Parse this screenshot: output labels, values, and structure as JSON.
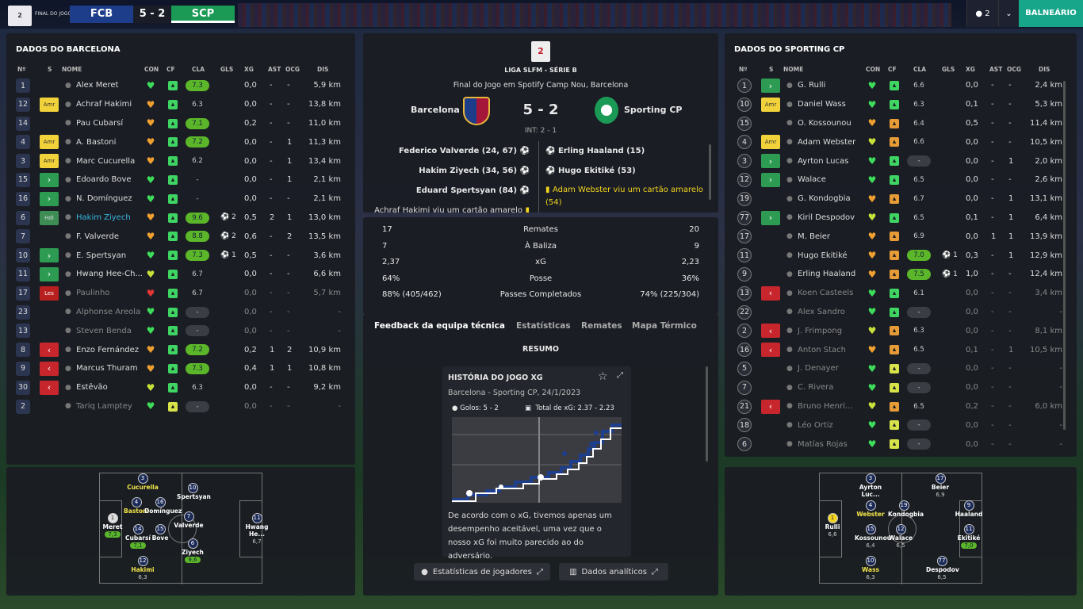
{
  "topbar": {
    "final_label": "FINAL DO JOGO",
    "home": "FCB",
    "score": "5 - 2",
    "away": "SCP",
    "players_count": "2",
    "dropdown": "⌄",
    "balneario": "BALNEÁRIO"
  },
  "left": {
    "title": "DADOS DO BARCELONA",
    "headers": {
      "n": "Nº",
      "s": "S",
      "name": "NOME",
      "con": "CON",
      "cf": "CF",
      "cla": "CLA",
      "gls": "GLS",
      "xg": "XG",
      "ast": "AST",
      "ocg": "OCG",
      "dis": "DIS"
    },
    "rows": [
      {
        "n": "1",
        "s": "",
        "name": "Alex Meret",
        "con": "g",
        "cf": "g",
        "cla": "7.3",
        "clat": "g",
        "gls": "",
        "xg": "0,0",
        "ast": "-",
        "ocg": "-",
        "dis": "5,9 km",
        "circ": false
      },
      {
        "n": "12",
        "s": "Amr",
        "name": "Achraf Hakimi",
        "con": "o",
        "cf": "g",
        "cla": "6.3",
        "clat": "t",
        "gls": "",
        "xg": "0,0",
        "ast": "-",
        "ocg": "-",
        "dis": "13,8 km",
        "circ": false
      },
      {
        "n": "14",
        "s": "",
        "name": "Pau Cubarsí",
        "con": "o",
        "cf": "g",
        "cla": "7.1",
        "clat": "g",
        "gls": "",
        "xg": "0,2",
        "ast": "-",
        "ocg": "-",
        "dis": "11,0 km",
        "circ": false
      },
      {
        "n": "4",
        "s": "Amr",
        "name": "A. Bastoni",
        "con": "o",
        "cf": "g",
        "cla": "7.2",
        "clat": "g",
        "gls": "",
        "xg": "0,0",
        "ast": "-",
        "ocg": "1",
        "dis": "11,3 km",
        "circ": false
      },
      {
        "n": "3",
        "s": "Amr",
        "name": "Marc Cucurella",
        "con": "o",
        "cf": "g",
        "cla": "6.2",
        "clat": "t",
        "gls": "",
        "xg": "0,0",
        "ast": "-",
        "ocg": "1",
        "dis": "13,4 km",
        "circ": false
      },
      {
        "n": "15",
        "s": "in",
        "name": "Edoardo Bove",
        "con": "g",
        "cf": "g",
        "cla": "-",
        "clat": "t",
        "gls": "",
        "xg": "0,0",
        "ast": "-",
        "ocg": "1",
        "dis": "2,1 km",
        "circ": false
      },
      {
        "n": "16",
        "s": "in",
        "name": "N. Domínguez",
        "con": "g",
        "cf": "g",
        "cla": "-",
        "clat": "t",
        "gls": "",
        "xg": "0,0",
        "ast": "-",
        "ocg": "-",
        "dis": "2,1 km",
        "circ": false
      },
      {
        "n": "6",
        "s": "Hdl",
        "name": "Hakim Ziyech",
        "con": "o",
        "cf": "g",
        "cla": "9.6",
        "clat": "g",
        "gls": "2",
        "xg": "0,5",
        "ast": "2",
        "ocg": "1",
        "dis": "13,0 km",
        "circ": false,
        "hl": true
      },
      {
        "n": "7",
        "s": "",
        "name": "F. Valverde",
        "con": "o",
        "cf": "g",
        "cla": "8.8",
        "clat": "g",
        "gls": "2",
        "xg": "0,6",
        "ast": "-",
        "ocg": "2",
        "dis": "13,5 km",
        "circ": false
      },
      {
        "n": "10",
        "s": "in",
        "name": "E. Spertsyan",
        "con": "g",
        "cf": "g",
        "cla": "7.3",
        "clat": "g",
        "gls": "1",
        "xg": "0,5",
        "ast": "-",
        "ocg": "-",
        "dis": "3,6 km",
        "circ": false
      },
      {
        "n": "11",
        "s": "in",
        "name": "Hwang Hee-Ch...",
        "con": "y",
        "cf": "g",
        "cla": "6.7",
        "clat": "t",
        "gls": "",
        "xg": "0,0",
        "ast": "-",
        "ocg": "-",
        "dis": "6,6 km",
        "circ": false
      },
      {
        "n": "17",
        "s": "Les",
        "name": "Paulinho",
        "con": "r",
        "cf": "g",
        "cla": "6.7",
        "clat": "t",
        "gls": "",
        "xg": "0,0",
        "ast": "-",
        "ocg": "-",
        "dis": "5,7 km",
        "circ": false,
        "dim": true
      },
      {
        "n": "23",
        "s": "",
        "name": "Alphonse Areola",
        "con": "g",
        "cf": "g",
        "cla": "-",
        "clat": "dk",
        "gls": "",
        "xg": "0,0",
        "ast": "-",
        "ocg": "-",
        "dis": "-",
        "circ": false,
        "dim": true
      },
      {
        "n": "13",
        "s": "",
        "name": "Steven Benda",
        "con": "g",
        "cf": "g",
        "cla": "-",
        "clat": "dk",
        "gls": "",
        "xg": "0,0",
        "ast": "-",
        "ocg": "-",
        "dis": "-",
        "circ": false,
        "dim": true
      },
      {
        "n": "8",
        "s": "out",
        "name": "Enzo Fernández",
        "con": "o",
        "cf": "g",
        "cla": "7.2",
        "clat": "g",
        "gls": "",
        "xg": "0,2",
        "ast": "1",
        "ocg": "2",
        "dis": "10,9 km",
        "circ": false
      },
      {
        "n": "9",
        "s": "out",
        "name": "Marcus Thuram",
        "con": "o",
        "cf": "g",
        "cla": "7.3",
        "clat": "g",
        "gls": "",
        "xg": "0,4",
        "ast": "1",
        "ocg": "1",
        "dis": "10,8 km",
        "circ": false
      },
      {
        "n": "30",
        "s": "out",
        "name": "Estêvão",
        "con": "y",
        "cf": "g",
        "cla": "6.3",
        "clat": "t",
        "gls": "",
        "xg": "0,0",
        "ast": "-",
        "ocg": "-",
        "dis": "9,2 km",
        "circ": false
      },
      {
        "n": "2",
        "s": "",
        "name": "Tariq Lamptey",
        "con": "g",
        "cf": "y",
        "cla": "-",
        "clat": "dk",
        "gls": "",
        "xg": "0,0",
        "ast": "-",
        "ocg": "-",
        "dis": "-",
        "circ": false,
        "dim": true
      }
    ]
  },
  "right": {
    "title": "DADOS DO SPORTING CP",
    "headers": {
      "n": "Nº",
      "s": "S",
      "name": "NOME",
      "con": "CON",
      "cf": "CF",
      "cla": "CLA",
      "gls": "GLS",
      "xg": "XG",
      "ast": "AST",
      "ocg": "OCG",
      "dis": "DIS"
    },
    "rows": [
      {
        "n": "1",
        "s": "in",
        "name": "G. Rulli",
        "con": "g",
        "cf": "g",
        "cla": "6.6",
        "clat": "t",
        "gls": "",
        "xg": "0,0",
        "ast": "-",
        "ocg": "-",
        "dis": "2,4 km",
        "circ": true
      },
      {
        "n": "10",
        "s": "Amr",
        "name": "Daniel Wass",
        "con": "g",
        "cf": "g",
        "cla": "6.3",
        "clat": "t",
        "gls": "",
        "xg": "0,1",
        "ast": "-",
        "ocg": "-",
        "dis": "5,3 km",
        "circ": true
      },
      {
        "n": "15",
        "s": "",
        "name": "O. Kossounou",
        "con": "o",
        "cf": "o",
        "cla": "6.4",
        "clat": "t",
        "gls": "",
        "xg": "0,5",
        "ast": "-",
        "ocg": "-",
        "dis": "11,4 km",
        "circ": true
      },
      {
        "n": "4",
        "s": "Amr",
        "name": "Adam Webster",
        "con": "y",
        "cf": "o",
        "cla": "6.6",
        "clat": "t",
        "gls": "",
        "xg": "0,0",
        "ast": "-",
        "ocg": "-",
        "dis": "10,5 km",
        "circ": true
      },
      {
        "n": "3",
        "s": "in",
        "name": "Ayrton Lucas",
        "con": "g",
        "cf": "g",
        "cla": "-",
        "clat": "dk",
        "gls": "",
        "xg": "0,0",
        "ast": "-",
        "ocg": "1",
        "dis": "2,0 km",
        "circ": true
      },
      {
        "n": "12",
        "s": "in",
        "name": "Walace",
        "con": "g",
        "cf": "g",
        "cla": "6.5",
        "clat": "t",
        "gls": "",
        "xg": "0,0",
        "ast": "-",
        "ocg": "-",
        "dis": "2,6 km",
        "circ": true
      },
      {
        "n": "19",
        "s": "",
        "name": "G. Kondogbia",
        "con": "o",
        "cf": "o",
        "cla": "6.7",
        "clat": "t",
        "gls": "",
        "xg": "0,0",
        "ast": "-",
        "ocg": "1",
        "dis": "13,1 km",
        "circ": true
      },
      {
        "n": "77",
        "s": "in",
        "name": "Kiril Despodov",
        "con": "y",
        "cf": "g",
        "cla": "6.5",
        "clat": "t",
        "gls": "",
        "xg": "0,1",
        "ast": "-",
        "ocg": "1",
        "dis": "6,4 km",
        "circ": true
      },
      {
        "n": "17",
        "s": "",
        "name": "M. Beier",
        "con": "o",
        "cf": "o",
        "cla": "6.9",
        "clat": "t",
        "gls": "",
        "xg": "0,0",
        "ast": "1",
        "ocg": "1",
        "dis": "13,9 km",
        "circ": true
      },
      {
        "n": "11",
        "s": "",
        "name": "Hugo Ekitiké",
        "con": "o",
        "cf": "o",
        "cla": "7.0",
        "clat": "g",
        "gls": "1",
        "xg": "0,3",
        "ast": "-",
        "ocg": "1",
        "dis": "12,9 km",
        "circ": true
      },
      {
        "n": "9",
        "s": "",
        "name": "Erling Haaland",
        "con": "o",
        "cf": "o",
        "cla": "7.5",
        "clat": "g",
        "gls": "1",
        "xg": "1,0",
        "ast": "-",
        "ocg": "-",
        "dis": "12,4 km",
        "circ": true
      },
      {
        "n": "13",
        "s": "out",
        "name": "Koen Casteels",
        "con": "g",
        "cf": "g",
        "cla": "6.1",
        "clat": "t",
        "gls": "",
        "xg": "0,0",
        "ast": "-",
        "ocg": "-",
        "dis": "3,4 km",
        "circ": true,
        "dim": true
      },
      {
        "n": "22",
        "s": "",
        "name": "Alex Sandro",
        "con": "g",
        "cf": "g",
        "cla": "-",
        "clat": "dk",
        "gls": "",
        "xg": "0,0",
        "ast": "-",
        "ocg": "-",
        "dis": "-",
        "circ": true,
        "dim": true
      },
      {
        "n": "2",
        "s": "out",
        "name": "J. Frimpong",
        "con": "y",
        "cf": "o",
        "cla": "6.3",
        "clat": "t",
        "gls": "",
        "xg": "0,0",
        "ast": "-",
        "ocg": "-",
        "dis": "8,1 km",
        "circ": true,
        "dim": true
      },
      {
        "n": "16",
        "s": "out",
        "name": "Anton Stach",
        "con": "o",
        "cf": "o",
        "cla": "6.5",
        "clat": "t",
        "gls": "",
        "xg": "0,1",
        "ast": "-",
        "ocg": "1",
        "dis": "10,5 km",
        "circ": true,
        "dim": true
      },
      {
        "n": "5",
        "s": "",
        "name": "J. Denayer",
        "con": "g",
        "cf": "y",
        "cla": "-",
        "clat": "dk",
        "gls": "",
        "xg": "0,0",
        "ast": "-",
        "ocg": "-",
        "dis": "-",
        "circ": true,
        "dim": true
      },
      {
        "n": "7",
        "s": "",
        "name": "C. Rivera",
        "con": "g",
        "cf": "y",
        "cla": "-",
        "clat": "dk",
        "gls": "",
        "xg": "0,0",
        "ast": "-",
        "ocg": "-",
        "dis": "-",
        "circ": true,
        "dim": true
      },
      {
        "n": "21",
        "s": "out",
        "name": "Bruno Henri...",
        "con": "y",
        "cf": "o",
        "cla": "6.5",
        "clat": "t",
        "gls": "",
        "xg": "0,2",
        "ast": "-",
        "ocg": "-",
        "dis": "6,0 km",
        "circ": true,
        "dim": true
      },
      {
        "n": "18",
        "s": "",
        "name": "Léo Ortiz",
        "con": "g",
        "cf": "y",
        "cla": "-",
        "clat": "dk",
        "gls": "",
        "xg": "0,0",
        "ast": "-",
        "ocg": "-",
        "dis": "-",
        "circ": true,
        "dim": true
      },
      {
        "n": "6",
        "s": "",
        "name": "Matías Rojas",
        "con": "g",
        "cf": "y",
        "cla": "-",
        "clat": "dk",
        "gls": "",
        "xg": "0,0",
        "ast": "-",
        "ocg": "-",
        "dis": "-",
        "circ": true,
        "dim": true
      }
    ]
  },
  "match": {
    "competition": "LIGA SLFM - SÉRIE B",
    "venue": "Final do Jogo em Spotify Camp Nou, Barcelona",
    "home": "Barcelona",
    "away": "Sporting CP",
    "score": "5 - 2",
    "interval": "INT: 2 - 1",
    "home_events": [
      "Federico Valverde (24, 67)",
      "Hakim Ziyech (34, 56)",
      "Eduard Spertsyan (84)",
      "Achraf Hakimi viu um cartão amarelo"
    ],
    "away_events": [
      "Erling Haaland (15)",
      "Hugo Ekitiké (53)",
      "Adam Webster viu um cartão amarelo (54)"
    ],
    "stats": [
      {
        "home": "17",
        "label": "Remates",
        "away": "20"
      },
      {
        "home": "7",
        "label": "À Baliza",
        "away": "9"
      },
      {
        "home": "2,37",
        "label": "xG",
        "away": "2,23"
      },
      {
        "home": "64%",
        "label": "Posse",
        "away": "36%"
      },
      {
        "home": "88% (405/462)",
        "label": "Passes Completados",
        "away": "74% (225/304)"
      }
    ],
    "tabs": [
      "Feedback da equipa técnica",
      "Estatísticas",
      "Remates",
      "Mapa Térmico"
    ],
    "resumo": "RESUMO",
    "xg_card": {
      "title": "HISTÓRIA DO JOGO XG",
      "subtitle": "Barcelona - Sporting CP, 24/1/2023",
      "goals": "Golos: 5 - 2",
      "xg_total": "Total de xG: 2.37 - 2.23",
      "text": "De acordo com o xG, tivemos apenas um desempenho aceitável, uma vez que o nosso xG foi muito parecido ao do adversário."
    },
    "btn_players": "Estatísticas de jogadores",
    "btn_analytics": "Dados analíticos"
  },
  "home_pitch": [
    {
      "num": "3",
      "name": "Cucurella",
      "rt": "",
      "ny": true
    },
    {
      "num": "10",
      "name": "Spertsyan",
      "rt": ""
    },
    {
      "num": "4",
      "name": "Bastoni",
      "rt": "",
      "ny": true
    },
    {
      "num": "16",
      "name": "Domínguez",
      "rt": ""
    },
    {
      "num": "1",
      "name": "Meret",
      "rt": "7,3"
    },
    {
      "num": "14",
      "name": "Cubarsí",
      "rt": "7,1"
    },
    {
      "num": "15",
      "name": "Bove",
      "rt": ""
    },
    {
      "num": "7",
      "name": "Valverde",
      "rt": ""
    },
    {
      "num": "6",
      "name": "Ziyech",
      "rt": "9,6"
    },
    {
      "num": "11",
      "name": "Hwang He...",
      "rt": "6,7"
    },
    {
      "num": "12",
      "name": "Hakimi",
      "rt": "6,3",
      "ny": true
    }
  ],
  "away_pitch": [
    {
      "num": "3",
      "name": "Ayrton Luc...",
      "rt": ""
    },
    {
      "num": "17",
      "name": "Beier",
      "rt": "6,9"
    },
    {
      "num": "4",
      "name": "Webster",
      "rt": "",
      "ny": true
    },
    {
      "num": "19",
      "name": "Kondogbia",
      "rt": ""
    },
    {
      "num": "9",
      "name": "Haaland",
      "rt": ""
    },
    {
      "num": "1",
      "name": "Rulli",
      "rt": "6,6"
    },
    {
      "num": "15",
      "name": "Kossounou",
      "rt": "6,4"
    },
    {
      "num": "12",
      "name": "Walace",
      "rt": "6,5"
    },
    {
      "num": "11",
      "name": "Ekitiké",
      "rt": "7,0"
    },
    {
      "num": "10",
      "name": "Wass",
      "rt": "6,3",
      "ny": true
    },
    {
      "num": "77",
      "name": "Despodov",
      "rt": "6,5"
    }
  ],
  "colors": {
    "accent": "#18a68a",
    "home": "#1d3c8a",
    "away": "#1a9a55",
    "rating_green": "#5bb62a"
  }
}
